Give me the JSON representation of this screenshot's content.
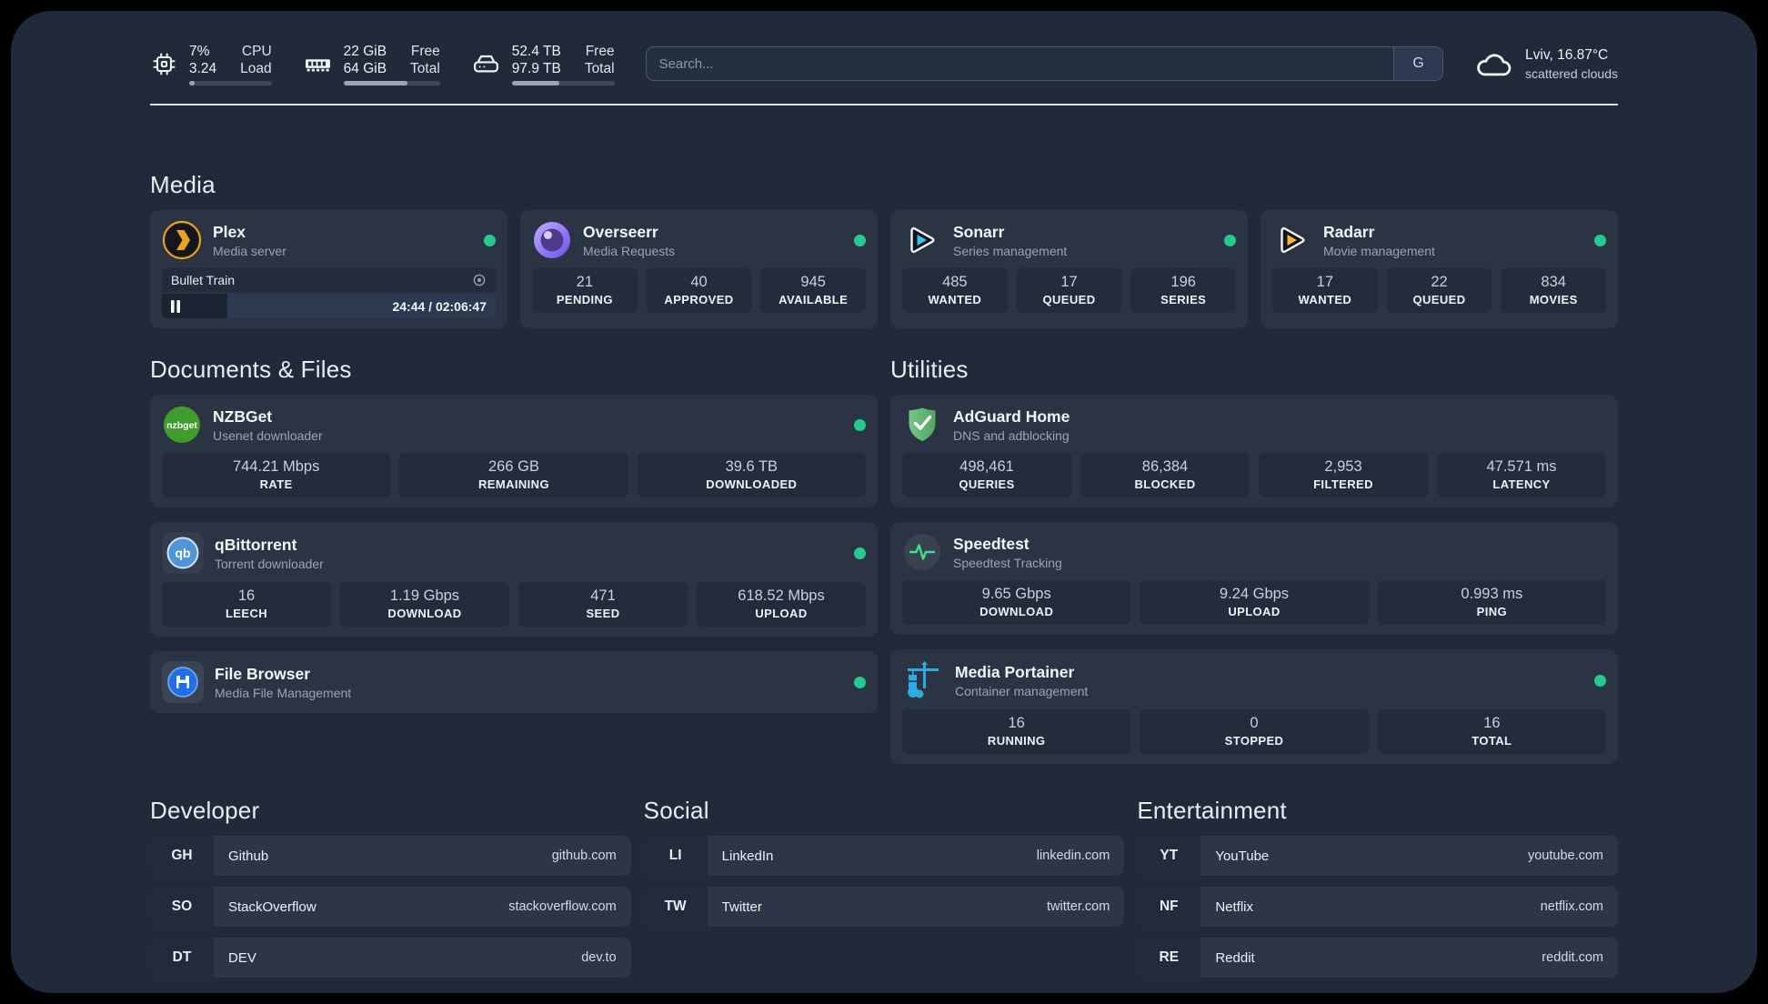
{
  "colors": {
    "status_green": "#26c98e",
    "panel_bg": "#202a39",
    "card_bg": "#2a3443"
  },
  "icons": [
    "cpu-icon",
    "memory-icon",
    "disk-icon",
    "cloud-icon",
    "plex-icon",
    "overseerr-icon",
    "sonarr-icon",
    "radarr-icon",
    "nzbget-icon",
    "qbittorrent-icon",
    "filebrowser-icon",
    "adguard-icon",
    "speedtest-icon",
    "portainer-icon",
    "pause-icon",
    "session-icon"
  ],
  "header": {
    "stats": [
      {
        "icon": "cpu-icon",
        "value1": "7%",
        "label1": "CPU",
        "value2": "3.24",
        "label2": "Load",
        "progress_pct": 7
      },
      {
        "icon": "memory-icon",
        "value1": "22 GiB",
        "label1": "Free",
        "value2": "64 GiB",
        "label2": "Total",
        "progress_pct": 66
      },
      {
        "icon": "disk-icon",
        "value1": "52.4 TB",
        "label1": "Free",
        "value2": "97.9 TB",
        "label2": "Total",
        "progress_pct": 46
      }
    ],
    "search": {
      "placeholder": "Search...",
      "button": "G"
    },
    "weather": {
      "line1": "Lviv, 16.87°C",
      "line2": "scattered clouds"
    }
  },
  "sections": {
    "media": {
      "title": "Media",
      "plex": {
        "name": "Plex",
        "desc": "Media server",
        "player": {
          "title": "Bullet Train",
          "time": "24:44 / 02:06:47",
          "progress_pct": 19.5
        }
      },
      "overseerr": {
        "name": "Overseerr",
        "desc": "Media Requests",
        "stats": [
          {
            "value": "21",
            "label": "PENDING"
          },
          {
            "value": "40",
            "label": "APPROVED"
          },
          {
            "value": "945",
            "label": "AVAILABLE"
          }
        ]
      },
      "sonarr": {
        "name": "Sonarr",
        "desc": "Series management",
        "stats": [
          {
            "value": "485",
            "label": "WANTED"
          },
          {
            "value": "17",
            "label": "QUEUED"
          },
          {
            "value": "196",
            "label": "SERIES"
          }
        ]
      },
      "radarr": {
        "name": "Radarr",
        "desc": "Movie management",
        "stats": [
          {
            "value": "17",
            "label": "WANTED"
          },
          {
            "value": "22",
            "label": "QUEUED"
          },
          {
            "value": "834",
            "label": "MOVIES"
          }
        ]
      }
    },
    "documents": {
      "title": "Documents & Files",
      "nzbget": {
        "name": "NZBGet",
        "desc": "Usenet downloader",
        "stats": [
          {
            "value": "744.21 Mbps",
            "label": "RATE"
          },
          {
            "value": "266 GB",
            "label": "REMAINING"
          },
          {
            "value": "39.6 TB",
            "label": "DOWNLOADED"
          }
        ]
      },
      "qbittorrent": {
        "name": "qBittorrent",
        "desc": "Torrent downloader",
        "stats": [
          {
            "value": "16",
            "label": "LEECH"
          },
          {
            "value": "1.19 Gbps",
            "label": "DOWNLOAD"
          },
          {
            "value": "471",
            "label": "SEED"
          },
          {
            "value": "618.52 Mbps",
            "label": "UPLOAD"
          }
        ]
      },
      "filebrowser": {
        "name": "File Browser",
        "desc": "Media File Management"
      }
    },
    "utilities": {
      "title": "Utilities",
      "adguard": {
        "name": "AdGuard Home",
        "desc": "DNS and adblocking",
        "stats": [
          {
            "value": "498,461",
            "label": "QUERIES"
          },
          {
            "value": "86,384",
            "label": "BLOCKED"
          },
          {
            "value": "2,953",
            "label": "FILTERED"
          },
          {
            "value": "47.571 ms",
            "label": "LATENCY"
          }
        ]
      },
      "speedtest": {
        "name": "Speedtest",
        "desc": "Speedtest Tracking",
        "stats": [
          {
            "value": "9.65 Gbps",
            "label": "DOWNLOAD"
          },
          {
            "value": "9.24 Gbps",
            "label": "UPLOAD"
          },
          {
            "value": "0.993 ms",
            "label": "PING"
          }
        ]
      },
      "portainer": {
        "name": "Media Portainer",
        "desc": "Container management",
        "stats": [
          {
            "value": "16",
            "label": "RUNNING"
          },
          {
            "value": "0",
            "label": "STOPPED"
          },
          {
            "value": "16",
            "label": "TOTAL"
          }
        ]
      }
    },
    "developer": {
      "title": "Developer",
      "links": [
        {
          "abbr": "GH",
          "name": "Github",
          "url": "github.com"
        },
        {
          "abbr": "SO",
          "name": "StackOverflow",
          "url": "stackoverflow.com"
        },
        {
          "abbr": "DT",
          "name": "DEV",
          "url": "dev.to"
        }
      ]
    },
    "social": {
      "title": "Social",
      "links": [
        {
          "abbr": "LI",
          "name": "LinkedIn",
          "url": "linkedin.com"
        },
        {
          "abbr": "TW",
          "name": "Twitter",
          "url": "twitter.com"
        }
      ]
    },
    "entertainment": {
      "title": "Entertainment",
      "links": [
        {
          "abbr": "YT",
          "name": "YouTube",
          "url": "youtube.com"
        },
        {
          "abbr": "NF",
          "name": "Netflix",
          "url": "netflix.com"
        },
        {
          "abbr": "RE",
          "name": "Reddit",
          "url": "reddit.com"
        }
      ]
    }
  }
}
